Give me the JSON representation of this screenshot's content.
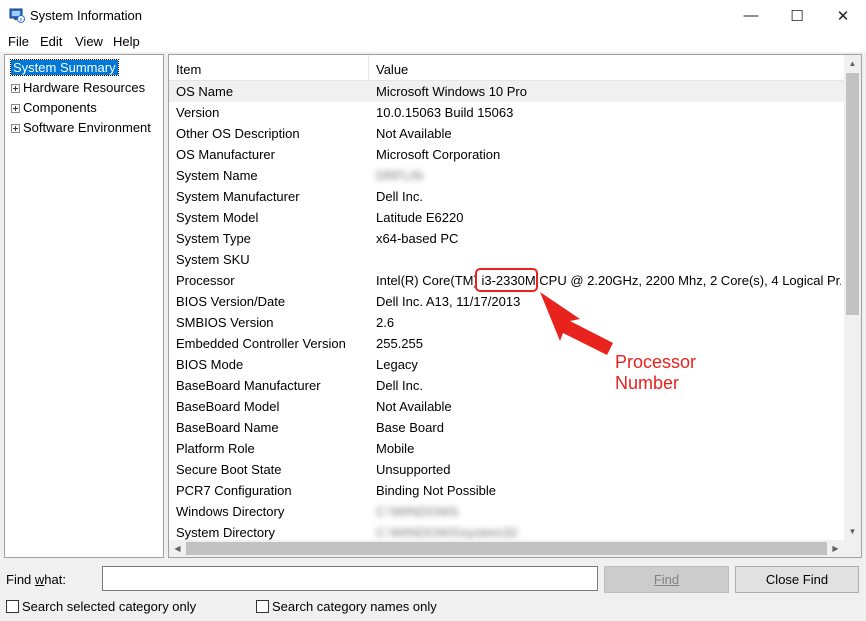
{
  "window": {
    "title": "System Information",
    "minimize": "—",
    "maximize": "☐",
    "close": "✕"
  },
  "menu": [
    "File",
    "Edit",
    "View",
    "Help"
  ],
  "tree": [
    {
      "label": "System Summary",
      "selected": true,
      "expandable": false
    },
    {
      "label": "Hardware Resources",
      "selected": false,
      "expandable": true
    },
    {
      "label": "Components",
      "selected": false,
      "expandable": true
    },
    {
      "label": "Software Environment",
      "selected": false,
      "expandable": true
    }
  ],
  "list": {
    "headers": {
      "item": "Item",
      "value": "Value"
    },
    "rows": [
      {
        "item": "OS Name",
        "value": "Microsoft Windows 10 Pro",
        "highlight": true
      },
      {
        "item": "Version",
        "value": "10.0.15063 Build 15063"
      },
      {
        "item": "Other OS Description",
        "value": "Not Available"
      },
      {
        "item": "OS Manufacturer",
        "value": "Microsoft Corporation"
      },
      {
        "item": "System Name",
        "value": "DRFLIN",
        "blurred": true
      },
      {
        "item": "System Manufacturer",
        "value": "Dell Inc."
      },
      {
        "item": "System Model",
        "value": "Latitude E6220"
      },
      {
        "item": "System Type",
        "value": "x64-based PC"
      },
      {
        "item": "System SKU",
        "value": ""
      },
      {
        "item": "Processor",
        "value": "Intel(R) Core(TM) i3-2330M CPU @ 2.20GHz, 2200 Mhz, 2 Core(s), 4 Logical Pr..."
      },
      {
        "item": "BIOS Version/Date",
        "value": "Dell Inc. A13, 11/17/2013"
      },
      {
        "item": "SMBIOS Version",
        "value": "2.6"
      },
      {
        "item": "Embedded Controller Version",
        "value": "255.255"
      },
      {
        "item": "BIOS Mode",
        "value": "Legacy"
      },
      {
        "item": "BaseBoard Manufacturer",
        "value": "Dell Inc."
      },
      {
        "item": "BaseBoard Model",
        "value": "Not Available"
      },
      {
        "item": "BaseBoard Name",
        "value": "Base Board"
      },
      {
        "item": "Platform Role",
        "value": "Mobile"
      },
      {
        "item": "Secure Boot State",
        "value": "Unsupported"
      },
      {
        "item": "PCR7 Configuration",
        "value": "Binding Not Possible"
      },
      {
        "item": "Windows Directory",
        "value": "C:\\WINDOWS",
        "blurred": true
      },
      {
        "item": "System Directory",
        "value": "C:\\WINDOWS\\system32",
        "blurred": true
      }
    ]
  },
  "annotation": {
    "highlighted_text": "i3-2330M",
    "label_line1": "Processor",
    "label_line2": "Number",
    "color": "#e8231e"
  },
  "find": {
    "label": "Find what:",
    "value": "",
    "find_button": "Find",
    "close_find_button": "Close Find",
    "search_selected_label": "Search selected category only",
    "search_names_label": "Search category names only"
  },
  "colors": {
    "selection": "#0078d7",
    "callout": "#e8231e"
  }
}
